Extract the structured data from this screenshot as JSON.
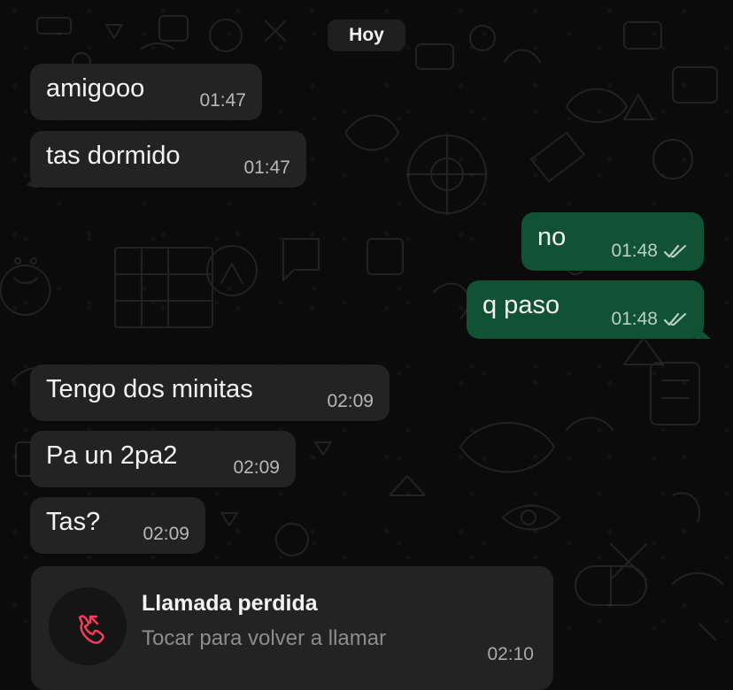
{
  "chat": {
    "date_label": "Hoy",
    "messages": [
      {
        "text": "amigooo",
        "time": "01:47"
      },
      {
        "text": "tas dormido",
        "time": "01:47"
      },
      {
        "text": "no",
        "time": "01:48"
      },
      {
        "text": "q paso",
        "time": "01:48"
      },
      {
        "text": "Tengo dos minitas",
        "time": "02:09"
      },
      {
        "text": "Pa un 2pa2",
        "time": "02:09"
      },
      {
        "text": "Tas?",
        "time": "02:09"
      }
    ],
    "missed_call": {
      "title": "Llamada perdida",
      "subtitle": "Tocar para volver a llamar",
      "time": "02:10"
    }
  },
  "icons": {
    "delivered_status": "double-check-icon",
    "call_status": "missed-call-icon"
  },
  "colors": {
    "background": "#0b0b0b",
    "incoming_bubble": "#232323",
    "outgoing_bubble": "#115134",
    "missed_call_red": "#ff3b5c"
  }
}
